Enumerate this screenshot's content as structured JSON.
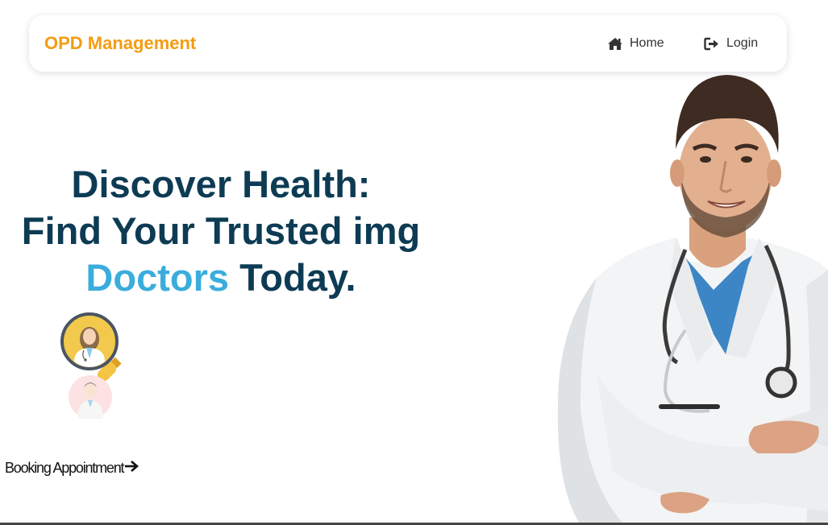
{
  "navbar": {
    "brand": "OPD Management",
    "links": [
      {
        "label": "Home",
        "icon": "home-icon"
      },
      {
        "label": "Login",
        "icon": "sign-in-icon"
      }
    ]
  },
  "hero": {
    "line1": "Discover Health:",
    "line2": "Find Your Trusted img",
    "line3_accent": "Doctors",
    "line3_rest": " Today."
  },
  "booking": {
    "label": "Booking Appointment",
    "icon": "arrow-right-icon"
  },
  "colors": {
    "brand": "#f39c12",
    "headline": "#0d3b54",
    "accent": "#3aaddc"
  }
}
